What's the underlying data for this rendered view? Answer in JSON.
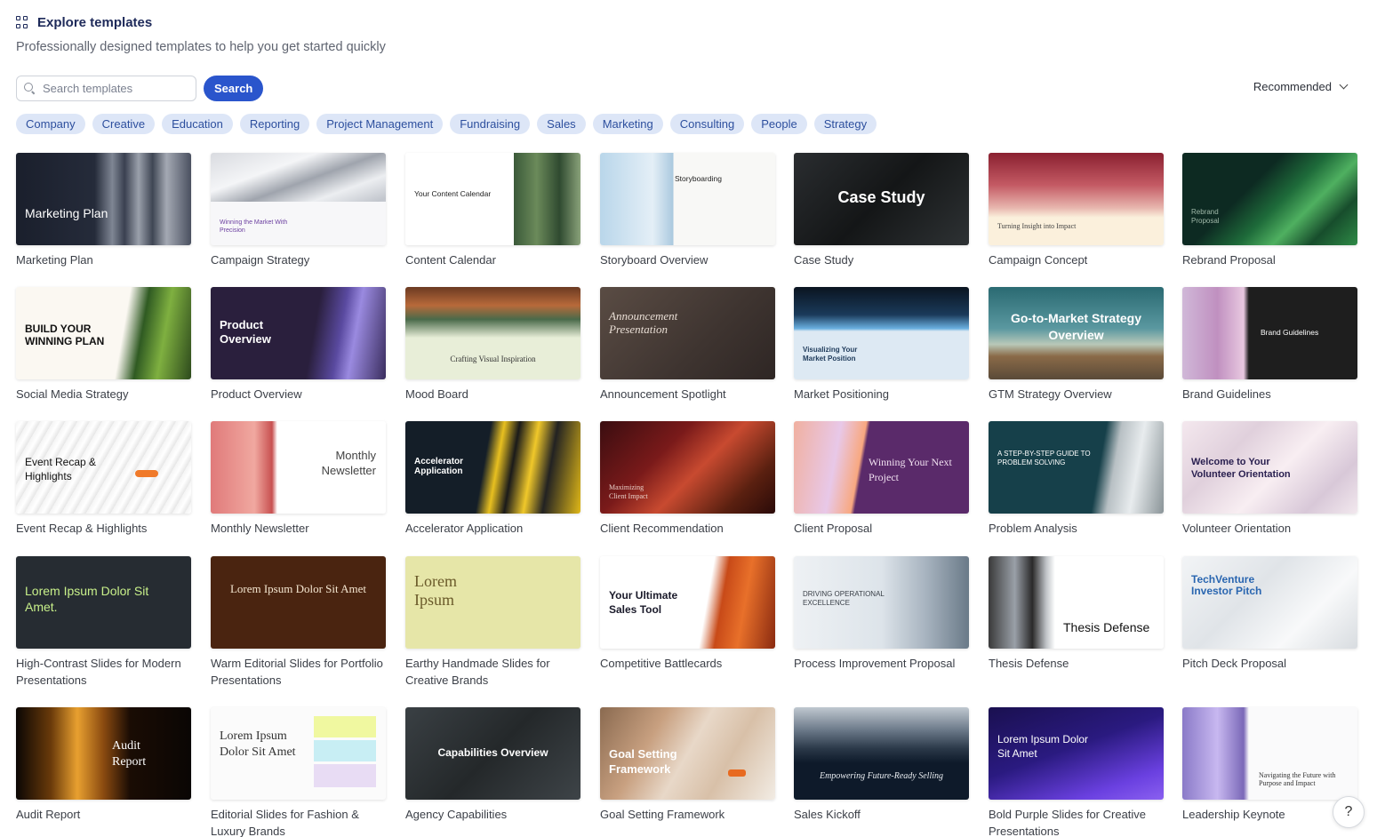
{
  "header": {
    "title": "Explore templates",
    "subtitle": "Professionally designed templates to help you get started quickly"
  },
  "search": {
    "placeholder": "Search templates",
    "button_label": "Search"
  },
  "sort": {
    "selected": "Recommended"
  },
  "categories": [
    "Company",
    "Creative",
    "Education",
    "Reporting",
    "Project Management",
    "Fundraising",
    "Sales",
    "Marketing",
    "Consulting",
    "People",
    "Strategy"
  ],
  "templates": [
    {
      "label": "Marketing Plan",
      "thumb_text": "Marketing Plan"
    },
    {
      "label": "Campaign Strategy",
      "thumb_text": "Winning the Market With Precision"
    },
    {
      "label": "Content Calendar",
      "thumb_text": "Your Content Calendar"
    },
    {
      "label": "Storyboard Overview",
      "thumb_text": "Storyboarding"
    },
    {
      "label": "Case Study",
      "thumb_text": "Case Study"
    },
    {
      "label": "Campaign Concept",
      "thumb_text": "Turning Insight into Impact"
    },
    {
      "label": "Rebrand Proposal",
      "thumb_text": "Rebrand Proposal"
    },
    {
      "label": "Social Media Strategy",
      "thumb_text": "BUILD YOUR WINNING PLAN"
    },
    {
      "label": "Product Overview",
      "thumb_text": "Product Overview"
    },
    {
      "label": "Mood Board",
      "thumb_text": "Crafting Visual Inspiration"
    },
    {
      "label": "Announcement Spotlight",
      "thumb_text": "Announcement Presentation"
    },
    {
      "label": "Market Positioning",
      "thumb_text": "Visualizing Your Market Position"
    },
    {
      "label": "GTM Strategy Overview",
      "thumb_text": "Go-to-Market Strategy Overview"
    },
    {
      "label": "Brand Guidelines",
      "thumb_text": "Brand Guidelines"
    },
    {
      "label": "Event Recap & Highlights",
      "thumb_text": "Event Recap & Highlights"
    },
    {
      "label": "Monthly Newsletter",
      "thumb_text": "Monthly Newsletter"
    },
    {
      "label": "Accelerator Application",
      "thumb_text": "Accelerator Application"
    },
    {
      "label": "Client Recommendation",
      "thumb_text": "Maximizing Client Impact"
    },
    {
      "label": "Client Proposal",
      "thumb_text": "Winning Your Next Project"
    },
    {
      "label": "Problem Analysis",
      "thumb_text": "A STEP-BY-STEP GUIDE TO PROBLEM SOLVING"
    },
    {
      "label": "Volunteer Orientation",
      "thumb_text": "Welcome to Your Volunteer Orientation"
    },
    {
      "label": "High-Contrast Slides for Modern Presentations",
      "thumb_text": "Lorem Ipsum Dolor Sit Amet."
    },
    {
      "label": "Warm Editorial Slides for Portfolio Presentations",
      "thumb_text": "Lorem Ipsum Dolor Sit Amet"
    },
    {
      "label": "Earthy Handmade Slides for Creative Brands",
      "thumb_text": "Lorem Ipsum"
    },
    {
      "label": "Competitive Battlecards",
      "thumb_text": "Your Ultimate Sales Tool"
    },
    {
      "label": "Process Improvement Proposal",
      "thumb_text": "DRIVING OPERATIONAL EXCELLENCE"
    },
    {
      "label": "Thesis Defense",
      "thumb_text": "Thesis Defense"
    },
    {
      "label": "Pitch Deck Proposal",
      "thumb_text": "TechVenture Investor Pitch"
    },
    {
      "label": "Audit Report",
      "thumb_text": "Audit Report"
    },
    {
      "label": "Editorial Slides for Fashion & Luxury Brands",
      "thumb_text": "Lorem Ipsum Dolor Sit Amet"
    },
    {
      "label": "Agency Capabilities",
      "thumb_text": "Capabilities Overview"
    },
    {
      "label": "Goal Setting Framework",
      "thumb_text": "Goal Setting Framework"
    },
    {
      "label": "Sales Kickoff",
      "thumb_text": "Empowering Future-Ready Selling"
    },
    {
      "label": "Bold Purple Slides for Creative Presentations",
      "thumb_text": "Lorem Ipsum Dolor Sit Amet"
    },
    {
      "label": "Leadership Keynote",
      "thumb_text": "Navigating the Future with Purpose and Impact"
    }
  ],
  "help": {
    "label": "?"
  },
  "colors": {
    "accent": "#2a55cc",
    "chip_bg": "#dde6f7",
    "chip_text": "#2d4f9e",
    "title": "#1e2a5a"
  }
}
